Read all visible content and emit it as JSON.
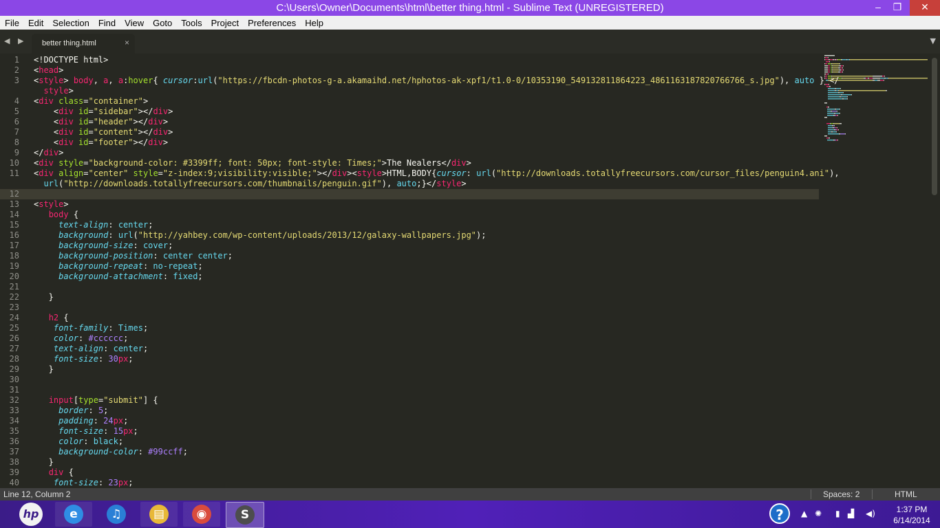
{
  "window": {
    "title": "C:\\Users\\Owner\\Documents\\html\\better thing.html - Sublime Text (UNREGISTERED)",
    "minimize": "–",
    "maximize": "❐",
    "close": "✕"
  },
  "menu": [
    "File",
    "Edit",
    "Selection",
    "Find",
    "View",
    "Goto",
    "Tools",
    "Project",
    "Preferences",
    "Help"
  ],
  "tab": {
    "title": "better thing.html",
    "close": "×",
    "nav_left": "◀",
    "nav_right": "▶",
    "menu": "▼"
  },
  "code": {
    "current_line": 12,
    "lines": [
      {
        "n": "1",
        "segs": [
          [
            "p",
            "<!DOCTYPE html>"
          ]
        ]
      },
      {
        "n": "2",
        "segs": [
          [
            "p",
            "<"
          ],
          [
            "t",
            "head"
          ],
          [
            "p",
            ">"
          ]
        ]
      },
      {
        "n": "3",
        "segs": [
          [
            "p",
            "<"
          ],
          [
            "t",
            "style"
          ],
          [
            "p",
            "> "
          ],
          [
            "t",
            "body"
          ],
          [
            "p",
            ", "
          ],
          [
            "t",
            "a"
          ],
          [
            "p",
            ", "
          ],
          [
            "t",
            "a"
          ],
          [
            "p",
            ":"
          ],
          [
            "a",
            "hover"
          ],
          [
            "p",
            "{ "
          ],
          [
            "k",
            "cursor"
          ],
          [
            "p",
            ":"
          ],
          [
            "v",
            "url"
          ],
          [
            "p",
            "("
          ],
          [
            "s",
            "\"https://fbcdn-photos-g-a.akamaihd.net/hphotos-ak-xpf1/t1.0-0/10353190_549132811864223_4861163187820766766_s.jpg\""
          ],
          [
            "p",
            "), "
          ],
          [
            "v",
            "auto"
          ],
          [
            "p",
            " } </"
          ]
        ]
      },
      {
        "n": "",
        "segs": [
          [
            "p",
            "  "
          ],
          [
            "t",
            "style"
          ],
          [
            "p",
            ">"
          ]
        ]
      },
      {
        "n": "4",
        "segs": [
          [
            "p",
            "<"
          ],
          [
            "t",
            "div"
          ],
          [
            "p",
            " "
          ],
          [
            "a",
            "class"
          ],
          [
            "p",
            "="
          ],
          [
            "s",
            "\"container\""
          ],
          [
            "p",
            ">"
          ]
        ]
      },
      {
        "n": "5",
        "segs": [
          [
            "p",
            "    <"
          ],
          [
            "t",
            "div"
          ],
          [
            "p",
            " "
          ],
          [
            "a",
            "id"
          ],
          [
            "p",
            "="
          ],
          [
            "s",
            "\"sidebar\""
          ],
          [
            "p",
            "></"
          ],
          [
            "t",
            "div"
          ],
          [
            "p",
            ">"
          ]
        ]
      },
      {
        "n": "6",
        "segs": [
          [
            "p",
            "    <"
          ],
          [
            "t",
            "div"
          ],
          [
            "p",
            " "
          ],
          [
            "a",
            "id"
          ],
          [
            "p",
            "="
          ],
          [
            "s",
            "\"header\""
          ],
          [
            "p",
            "></"
          ],
          [
            "t",
            "div"
          ],
          [
            "p",
            ">"
          ]
        ]
      },
      {
        "n": "7",
        "segs": [
          [
            "p",
            "    <"
          ],
          [
            "t",
            "div"
          ],
          [
            "p",
            " "
          ],
          [
            "a",
            "id"
          ],
          [
            "p",
            "="
          ],
          [
            "s",
            "\"content\""
          ],
          [
            "p",
            "></"
          ],
          [
            "t",
            "div"
          ],
          [
            "p",
            ">"
          ]
        ]
      },
      {
        "n": "8",
        "segs": [
          [
            "p",
            "    <"
          ],
          [
            "t",
            "div"
          ],
          [
            "p",
            " "
          ],
          [
            "a",
            "id"
          ],
          [
            "p",
            "="
          ],
          [
            "s",
            "\"footer\""
          ],
          [
            "p",
            "></"
          ],
          [
            "t",
            "div"
          ],
          [
            "p",
            ">"
          ]
        ]
      },
      {
        "n": "9",
        "segs": [
          [
            "p",
            "</"
          ],
          [
            "t",
            "div"
          ],
          [
            "p",
            ">"
          ]
        ]
      },
      {
        "n": "10",
        "segs": [
          [
            "p",
            "<"
          ],
          [
            "t",
            "div"
          ],
          [
            "p",
            " "
          ],
          [
            "a",
            "style"
          ],
          [
            "p",
            "="
          ],
          [
            "s",
            "\"background-color: #3399ff; font: 50px; font-style: Times;\""
          ],
          [
            "p",
            ">The Nealers</"
          ],
          [
            "t",
            "div"
          ],
          [
            "p",
            ">"
          ]
        ]
      },
      {
        "n": "11",
        "segs": [
          [
            "p",
            "<"
          ],
          [
            "t",
            "div"
          ],
          [
            "p",
            " "
          ],
          [
            "a",
            "align"
          ],
          [
            "p",
            "="
          ],
          [
            "s",
            "\"center\""
          ],
          [
            "p",
            " "
          ],
          [
            "a",
            "style"
          ],
          [
            "p",
            "="
          ],
          [
            "s",
            "\"z-index:9;visibility:visible;\""
          ],
          [
            "p",
            "></"
          ],
          [
            "t",
            "div"
          ],
          [
            "p",
            "><"
          ],
          [
            "t",
            "style"
          ],
          [
            "p",
            ">HTML,BODY{"
          ],
          [
            "k",
            "cursor"
          ],
          [
            "p",
            ": "
          ],
          [
            "v",
            "url"
          ],
          [
            "p",
            "("
          ],
          [
            "s",
            "\"http://downloads.totallyfreecursors.com/cursor_files/penguin4.ani\""
          ],
          [
            "p",
            "),"
          ]
        ]
      },
      {
        "n": "",
        "segs": [
          [
            "p",
            "  "
          ],
          [
            "v",
            "url"
          ],
          [
            "p",
            "("
          ],
          [
            "s",
            "\"http://downloads.totallyfreecursors.com/thumbnails/penguin.gif\""
          ],
          [
            "p",
            "), "
          ],
          [
            "v",
            "auto"
          ],
          [
            "p",
            ";}</"
          ],
          [
            "t",
            "style"
          ],
          [
            "p",
            ">"
          ]
        ]
      },
      {
        "n": "12",
        "segs": [
          [
            "p",
            ""
          ]
        ]
      },
      {
        "n": "13",
        "segs": [
          [
            "p",
            "<"
          ],
          [
            "t",
            "style"
          ],
          [
            "p",
            ">"
          ]
        ]
      },
      {
        "n": "14",
        "segs": [
          [
            "p",
            "   "
          ],
          [
            "t",
            "body"
          ],
          [
            "p",
            " {"
          ]
        ]
      },
      {
        "n": "15",
        "segs": [
          [
            "p",
            "     "
          ],
          [
            "k",
            "text-align"
          ],
          [
            "p",
            ": "
          ],
          [
            "v",
            "center"
          ],
          [
            "p",
            ";"
          ]
        ]
      },
      {
        "n": "16",
        "segs": [
          [
            "p",
            "     "
          ],
          [
            "k",
            "background"
          ],
          [
            "p",
            ": "
          ],
          [
            "v",
            "url"
          ],
          [
            "p",
            "("
          ],
          [
            "s",
            "\"http://yahbey.com/wp-content/uploads/2013/12/galaxy-wallpapers.jpg\""
          ],
          [
            "p",
            ");"
          ]
        ]
      },
      {
        "n": "17",
        "segs": [
          [
            "p",
            "     "
          ],
          [
            "k",
            "background-size"
          ],
          [
            "p",
            ": "
          ],
          [
            "v",
            "cover"
          ],
          [
            "p",
            ";"
          ]
        ]
      },
      {
        "n": "18",
        "segs": [
          [
            "p",
            "     "
          ],
          [
            "k",
            "background-position"
          ],
          [
            "p",
            ": "
          ],
          [
            "v",
            "center center"
          ],
          [
            "p",
            ";"
          ]
        ]
      },
      {
        "n": "19",
        "segs": [
          [
            "p",
            "     "
          ],
          [
            "k",
            "background-repeat"
          ],
          [
            "p",
            ": "
          ],
          [
            "v",
            "no-repeat"
          ],
          [
            "p",
            ";"
          ]
        ]
      },
      {
        "n": "20",
        "segs": [
          [
            "p",
            "     "
          ],
          [
            "k",
            "background-attachment"
          ],
          [
            "p",
            ": "
          ],
          [
            "v",
            "fixed"
          ],
          [
            "p",
            ";"
          ]
        ]
      },
      {
        "n": "21",
        "segs": [
          [
            "p",
            ""
          ]
        ]
      },
      {
        "n": "22",
        "segs": [
          [
            "p",
            "   }"
          ]
        ]
      },
      {
        "n": "23",
        "segs": [
          [
            "p",
            ""
          ]
        ]
      },
      {
        "n": "24",
        "segs": [
          [
            "p",
            "   "
          ],
          [
            "t",
            "h2"
          ],
          [
            "p",
            " {"
          ]
        ]
      },
      {
        "n": "25",
        "segs": [
          [
            "p",
            "    "
          ],
          [
            "k",
            "font-family"
          ],
          [
            "p",
            ": "
          ],
          [
            "v",
            "Times"
          ],
          [
            "p",
            ";"
          ]
        ]
      },
      {
        "n": "26",
        "segs": [
          [
            "p",
            "    "
          ],
          [
            "k",
            "color"
          ],
          [
            "p",
            ": "
          ],
          [
            "n",
            "#cccccc"
          ],
          [
            "p",
            ";"
          ]
        ]
      },
      {
        "n": "27",
        "segs": [
          [
            "p",
            "    "
          ],
          [
            "k",
            "text-align"
          ],
          [
            "p",
            ": "
          ],
          [
            "v",
            "center"
          ],
          [
            "p",
            ";"
          ]
        ]
      },
      {
        "n": "28",
        "segs": [
          [
            "p",
            "    "
          ],
          [
            "k",
            "font-size"
          ],
          [
            "p",
            ": "
          ],
          [
            "n",
            "30"
          ],
          [
            "t",
            "px"
          ],
          [
            "p",
            ";"
          ]
        ]
      },
      {
        "n": "29",
        "segs": [
          [
            "p",
            "   }"
          ]
        ]
      },
      {
        "n": "30",
        "segs": [
          [
            "p",
            ""
          ]
        ]
      },
      {
        "n": "31",
        "segs": [
          [
            "p",
            ""
          ]
        ]
      },
      {
        "n": "32",
        "segs": [
          [
            "p",
            "   "
          ],
          [
            "t",
            "input"
          ],
          [
            "p",
            "["
          ],
          [
            "a",
            "type"
          ],
          [
            "p",
            "="
          ],
          [
            "s",
            "\"submit\""
          ],
          [
            "p",
            "] {"
          ]
        ]
      },
      {
        "n": "33",
        "segs": [
          [
            "p",
            "     "
          ],
          [
            "k",
            "border"
          ],
          [
            "p",
            ": "
          ],
          [
            "n",
            "5"
          ],
          [
            "p",
            ";"
          ]
        ]
      },
      {
        "n": "34",
        "segs": [
          [
            "p",
            "     "
          ],
          [
            "k",
            "padding"
          ],
          [
            "p",
            ": "
          ],
          [
            "n",
            "24"
          ],
          [
            "t",
            "px"
          ],
          [
            "p",
            ";"
          ]
        ]
      },
      {
        "n": "35",
        "segs": [
          [
            "p",
            "     "
          ],
          [
            "k",
            "font-size"
          ],
          [
            "p",
            ": "
          ],
          [
            "n",
            "15"
          ],
          [
            "t",
            "px"
          ],
          [
            "p",
            ";"
          ]
        ]
      },
      {
        "n": "36",
        "segs": [
          [
            "p",
            "     "
          ],
          [
            "k",
            "color"
          ],
          [
            "p",
            ": "
          ],
          [
            "v",
            "black"
          ],
          [
            "p",
            ";"
          ]
        ]
      },
      {
        "n": "37",
        "segs": [
          [
            "p",
            "     "
          ],
          [
            "k",
            "background-color"
          ],
          [
            "p",
            ": "
          ],
          [
            "n",
            "#99ccff"
          ],
          [
            "p",
            ";"
          ]
        ]
      },
      {
        "n": "38",
        "segs": [
          [
            "p",
            "   }"
          ]
        ]
      },
      {
        "n": "39",
        "segs": [
          [
            "p",
            "   "
          ],
          [
            "t",
            "div"
          ],
          [
            "p",
            " {"
          ]
        ]
      },
      {
        "n": "40",
        "segs": [
          [
            "p",
            "    "
          ],
          [
            "k",
            "font-size"
          ],
          [
            "p",
            ": "
          ],
          [
            "n",
            "23"
          ],
          [
            "t",
            "px"
          ],
          [
            "p",
            ";"
          ]
        ]
      }
    ]
  },
  "status": {
    "position": "Line 12, Column 2",
    "indent": "Spaces: 2",
    "syntax": "HTML"
  },
  "taskbar": {
    "start_label": "hp",
    "apps": [
      {
        "name": "ie",
        "glyph": "e",
        "color": "#2f8de4"
      },
      {
        "name": "itunes",
        "glyph": "♫",
        "color": "#2a7fd6"
      },
      {
        "name": "explorer",
        "glyph": "▤",
        "color": "#e8b838"
      },
      {
        "name": "chrome",
        "glyph": "◉",
        "color": "#d94b3d"
      },
      {
        "name": "sublime",
        "glyph": "S",
        "color": "#4d4d4d"
      }
    ],
    "help_glyph": "?",
    "clock_time": "1:37 PM",
    "clock_date": "6/14/2014"
  },
  "colors": {
    "titlebar": "#8b47e6",
    "editor_bg": "#272822",
    "tag": "#f92672",
    "attr": "#a6e22e",
    "string": "#e6db74",
    "keyword": "#66d9ef",
    "number": "#ae81ff"
  }
}
